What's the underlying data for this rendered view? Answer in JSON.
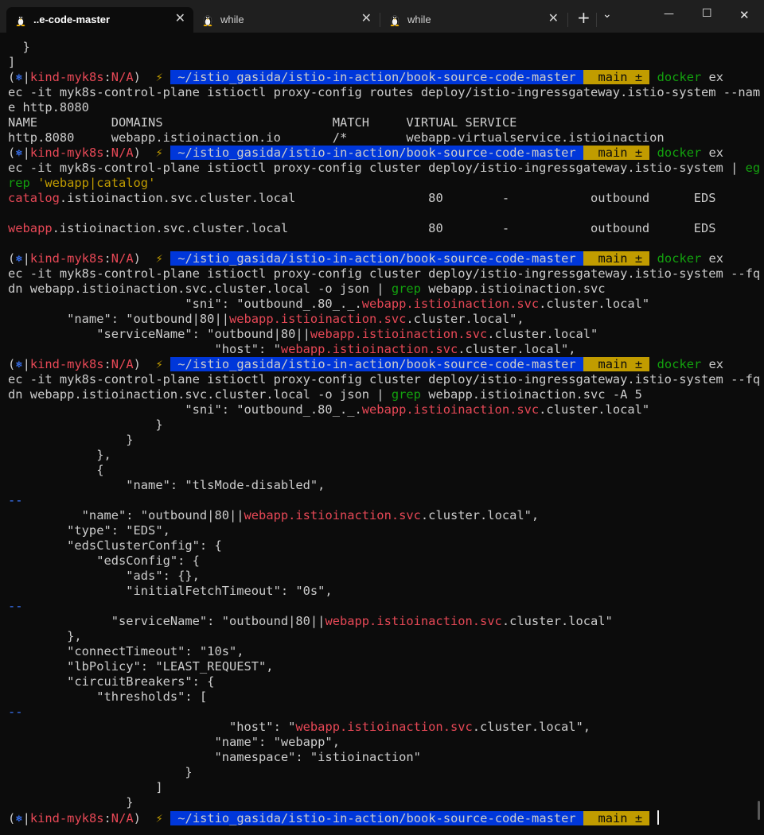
{
  "window": {
    "tabs": [
      {
        "label": "..e-code-master",
        "icon": "tux-icon",
        "active": true
      },
      {
        "label": "while",
        "icon": "tux-icon",
        "active": false
      },
      {
        "label": "while",
        "icon": "tux-icon",
        "active": false
      }
    ],
    "new_tab_glyph": "+",
    "dropdown_glyph": "⌄",
    "minimize_glyph": "—",
    "maximize_glyph": "☐",
    "close_glyph": "✕",
    "tab_close_glyph": "✕"
  },
  "prompt": {
    "open": "(",
    "k8s_icon": "⎈",
    "sep": "|",
    "context": "kind-myk8s",
    "colon": ":",
    "namespace": "N/A",
    "close": ")",
    "bolt": "⚡",
    "path": "~/istio_gasida/istio-in-action/book-source-code-master",
    "branch_glyph": "",
    "branch": "main ±"
  },
  "terminal": {
    "lines": [
      [
        {
          "t": "  }",
          "c": "w"
        }
      ],
      [
        {
          "t": "]",
          "c": "w"
        }
      ],
      [
        {
          "prompt": true
        },
        {
          "t": " docker",
          "c": "grn"
        },
        {
          "t": " ex",
          "c": "w"
        }
      ],
      [
        {
          "t": "ec -it myk8s-control-plane istioctl proxy-config routes deploy/istio-ingressgateway.istio-system --nam",
          "c": "w"
        }
      ],
      [
        {
          "t": "e http.8080",
          "c": "w"
        }
      ],
      [
        {
          "t": "NAME          DOMAINS                       MATCH     VIRTUAL SERVICE",
          "c": "w"
        }
      ],
      [
        {
          "t": "http.8080     webapp.istioinaction.io       /*        webapp-virtualservice.istioinaction",
          "c": "w"
        }
      ],
      [
        {
          "prompt": true
        },
        {
          "t": " docker",
          "c": "grn"
        },
        {
          "t": " ex",
          "c": "w"
        }
      ],
      [
        {
          "t": "ec -it myk8s-control-plane istioctl proxy-config cluster deploy/istio-ingressgateway.istio-system | ",
          "c": "w"
        },
        {
          "t": "eg",
          "c": "grn"
        }
      ],
      [
        {
          "t": "rep",
          "c": "grn"
        },
        {
          "t": " 'webapp|catalog'",
          "c": "ylw"
        }
      ],
      [
        {
          "t": "catalog",
          "c": "red"
        },
        {
          "t": ".istioinaction.svc.cluster.local                  80        -           outbound      EDS",
          "c": "w"
        }
      ],
      [],
      [
        {
          "t": "webapp",
          "c": "red"
        },
        {
          "t": ".istioinaction.svc.cluster.local                   80        -           outbound      EDS",
          "c": "w"
        }
      ],
      [],
      [
        {
          "prompt": true
        },
        {
          "t": " docker",
          "c": "grn"
        },
        {
          "t": " ex",
          "c": "w"
        }
      ],
      [
        {
          "t": "ec -it myk8s-control-plane istioctl proxy-config cluster deploy/istio-ingressgateway.istio-system --fq",
          "c": "w"
        }
      ],
      [
        {
          "t": "dn webapp.istioinaction.svc.cluster.local -o json | ",
          "c": "w"
        },
        {
          "t": "grep",
          "c": "grn"
        },
        {
          "t": " webapp.istioinaction.svc",
          "c": "w"
        }
      ],
      [
        {
          "t": "                        \"sni\": \"outbound_.80_._.",
          "c": "w"
        },
        {
          "t": "webapp.istioinaction.svc",
          "c": "red"
        },
        {
          "t": ".cluster.local\"",
          "c": "w"
        }
      ],
      [
        {
          "t": "        \"name\": \"outbound|80||",
          "c": "w"
        },
        {
          "t": "webapp.istioinaction.svc",
          "c": "red"
        },
        {
          "t": ".cluster.local\",",
          "c": "w"
        }
      ],
      [
        {
          "t": "            \"serviceName\": \"outbound|80||",
          "c": "w"
        },
        {
          "t": "webapp.istioinaction.svc",
          "c": "red"
        },
        {
          "t": ".cluster.local\"",
          "c": "w"
        }
      ],
      [
        {
          "t": "                            \"host\": \"",
          "c": "w"
        },
        {
          "t": "webapp.istioinaction.svc",
          "c": "red"
        },
        {
          "t": ".cluster.local\",",
          "c": "w"
        }
      ],
      [
        {
          "prompt": true
        },
        {
          "t": " docker",
          "c": "grn"
        },
        {
          "t": " ex",
          "c": "w"
        }
      ],
      [
        {
          "t": "ec -it myk8s-control-plane istioctl proxy-config cluster deploy/istio-ingressgateway.istio-system --fq",
          "c": "w"
        }
      ],
      [
        {
          "t": "dn webapp.istioinaction.svc.cluster.local -o json | ",
          "c": "w"
        },
        {
          "t": "grep",
          "c": "grn"
        },
        {
          "t": " webapp.istioinaction.svc -A 5",
          "c": "w"
        }
      ],
      [
        {
          "t": "                        \"sni\": \"outbound_.80_._.",
          "c": "w"
        },
        {
          "t": "webapp.istioinaction.svc",
          "c": "red"
        },
        {
          "t": ".cluster.local\"",
          "c": "w"
        }
      ],
      [
        {
          "t": "                    }",
          "c": "w"
        }
      ],
      [
        {
          "t": "                }",
          "c": "w"
        }
      ],
      [
        {
          "t": "            },",
          "c": "w"
        }
      ],
      [
        {
          "t": "            {",
          "c": "w"
        }
      ],
      [
        {
          "t": "                \"name\": \"tlsMode-disabled\",",
          "c": "w"
        }
      ],
      [
        {
          "t": "--",
          "c": "blu"
        }
      ],
      [
        {
          "t": "          \"name\": \"outbound|80||",
          "c": "w"
        },
        {
          "t": "webapp.istioinaction.svc",
          "c": "red"
        },
        {
          "t": ".cluster.local\",",
          "c": "w"
        }
      ],
      [
        {
          "t": "        \"type\": \"EDS\",",
          "c": "w"
        }
      ],
      [
        {
          "t": "        \"edsClusterConfig\": {",
          "c": "w"
        }
      ],
      [
        {
          "t": "            \"edsConfig\": {",
          "c": "w"
        }
      ],
      [
        {
          "t": "                \"ads\": {},",
          "c": "w"
        }
      ],
      [
        {
          "t": "                \"initialFetchTimeout\": \"0s\",",
          "c": "w"
        }
      ],
      [
        {
          "t": "--",
          "c": "blu"
        }
      ],
      [
        {
          "t": "              \"serviceName\": \"outbound|80||",
          "c": "w"
        },
        {
          "t": "webapp.istioinaction.svc",
          "c": "red"
        },
        {
          "t": ".cluster.local\"",
          "c": "w"
        }
      ],
      [
        {
          "t": "        },",
          "c": "w"
        }
      ],
      [
        {
          "t": "        \"connectTimeout\": \"10s\",",
          "c": "w"
        }
      ],
      [
        {
          "t": "        \"lbPolicy\": \"LEAST_REQUEST\",",
          "c": "w"
        }
      ],
      [
        {
          "t": "        \"circuitBreakers\": {",
          "c": "w"
        }
      ],
      [
        {
          "t": "            \"thresholds\": [",
          "c": "w"
        }
      ],
      [
        {
          "t": "--",
          "c": "blu"
        }
      ],
      [
        {
          "t": "                              \"host\": \"",
          "c": "w"
        },
        {
          "t": "webapp.istioinaction.svc",
          "c": "red"
        },
        {
          "t": ".cluster.local\",",
          "c": "w"
        }
      ],
      [
        {
          "t": "                            \"name\": \"webapp\",",
          "c": "w"
        }
      ],
      [
        {
          "t": "                            \"namespace\": \"istioinaction\"",
          "c": "w"
        }
      ],
      [
        {
          "t": "                        }",
          "c": "w"
        }
      ],
      [
        {
          "t": "                    ]",
          "c": "w"
        }
      ],
      [
        {
          "t": "                }",
          "c": "w"
        }
      ],
      [
        {
          "prompt": true
        },
        {
          "t": " ",
          "c": "w"
        },
        {
          "cursor": true
        }
      ]
    ]
  }
}
